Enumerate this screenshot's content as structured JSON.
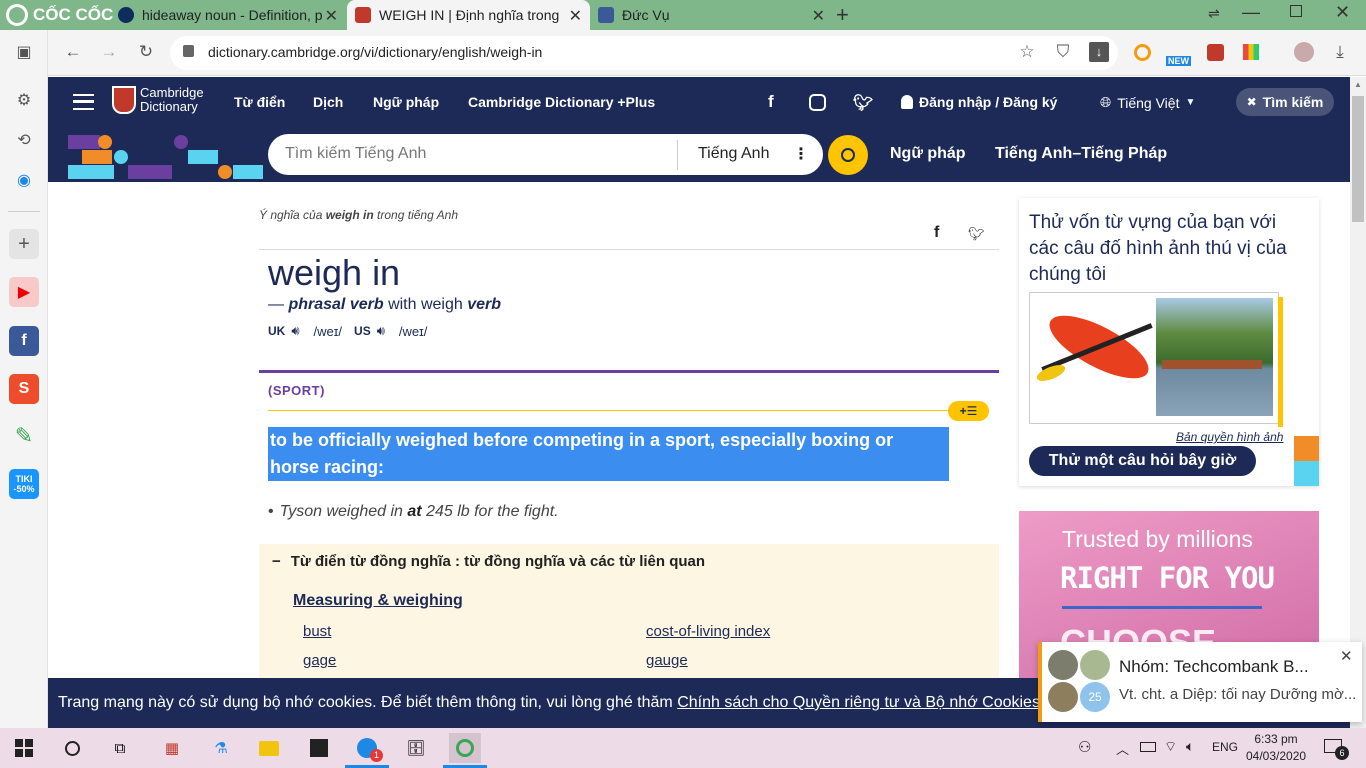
{
  "browser": {
    "brand": "CỐC CỐC",
    "tabs": [
      {
        "title": "hideaway noun - Definition, p"
      },
      {
        "title": "WEIGH IN | Định nghĩa trong"
      },
      {
        "title": "Đức Vụ"
      }
    ],
    "url": "dictionary.cambridge.org/vi/dictionary/english/weigh-in",
    "ext_badge": "NEW"
  },
  "site": {
    "logo_line1": "Cambridge",
    "logo_line2": "Dictionary",
    "nav": [
      "Từ điển",
      "Dịch",
      "Ngữ pháp",
      "Cambridge Dictionary +Plus"
    ],
    "login": "Đăng nhập / Đăng ký",
    "language": "Tiếng Việt",
    "search_toggle": "Tìm kiếm",
    "search_placeholder": "Tìm kiếm Tiếng Anh",
    "search_lang": "Tiếng Anh",
    "quicklinks": [
      "Ngữ pháp",
      "Tiếng Anh–Tiếng Pháp"
    ]
  },
  "entry": {
    "breadcrumb_pre": "Ý nghĩa của ",
    "breadcrumb_word": "weigh in",
    "breadcrumb_post": " trong tiếng Anh",
    "headword": "weigh in",
    "pos_dash": "—",
    "pos": "phrasal verb",
    "pos_with": "with weigh",
    "pos_verb": "verb",
    "uk_label": "UK",
    "uk_ipa": "/weɪ/",
    "us_label": "US",
    "us_ipa": "/weɪ/",
    "domain": "(SPORT)",
    "definition": "to be officially weighed before competing in a sport, especially boxing or horse racing:",
    "example_pre": "Tyson weighed in ",
    "example_bold": "at",
    "example_post": " 245 lb for the fight.",
    "thesaurus_title": "Từ điển từ đồng nghĩa : từ đồng nghĩa và các từ liên quan",
    "thesaurus_cat": "Measuring & weighing",
    "thesaurus_words": [
      "bust",
      "cost-of-living index",
      "gage",
      "gauge"
    ]
  },
  "sidebar": {
    "quiz_text": "Thử vốn từ vựng của bạn với các câu đố hình ảnh thú vị của chúng tôi",
    "copyright": "Bản quyền hình ảnh",
    "quiz_button": "Thử một câu hỏi bây giờ",
    "ad_line1": "Trusted by millions",
    "ad_line2": "RIGHT FOR YOU",
    "ad_line3": "CHOOSE"
  },
  "cookie": {
    "text": "Trang mạng này có sử dụng bộ nhớ cookies. Để biết thêm thông tin, vui lòng ghé thăm ",
    "link": "Chính sách cho Quyền riêng tư và Bộ nhớ Cookies"
  },
  "notification": {
    "title": "Nhóm: Techcombank B...",
    "body": "Vt. cht. a Diệp: tối nay Dưỡng mờ...",
    "avatar_count": "25"
  },
  "taskbar": {
    "lang": "ENG",
    "time": "6:33 pm",
    "date": "04/03/2020",
    "zalo_badge": "1",
    "notif_count": "6"
  },
  "colors": {
    "brand_navy": "#1d2a57",
    "accent_yellow": "#fec400",
    "highlight_blue": "#3c8df0",
    "tab_green": "#7fb78a"
  }
}
